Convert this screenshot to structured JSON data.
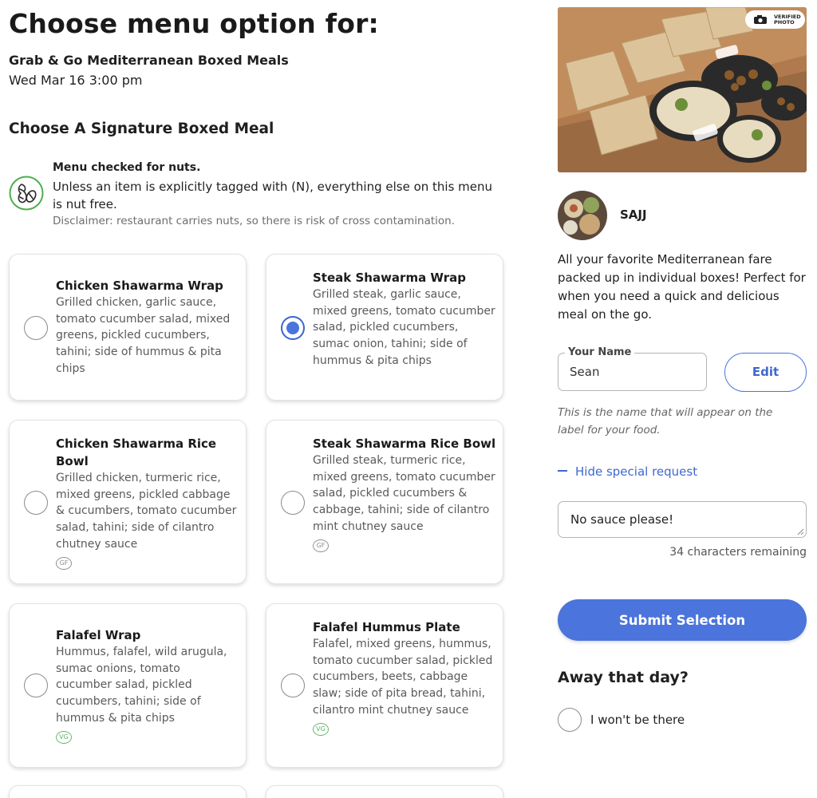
{
  "header": {
    "title": "Choose menu option for:",
    "event_name": "Grab & Go Mediterranean Boxed Meals",
    "event_date": "Wed Mar 16 3:00 pm",
    "section_title": "Choose A Signature Boxed Meal"
  },
  "nut_notice": {
    "icon": "nut-icon",
    "title": "Menu checked for nuts.",
    "text": "Unless an item is explicitly tagged with (N), everything else on this menu is nut free.",
    "disclaimer": "Disclaimer: restaurant carries nuts, so there is risk of cross contamination."
  },
  "menu_items": [
    {
      "name": "Chicken Shawarma Wrap",
      "description": "Grilled chicken, garlic sauce, tomato cucumber salad, mixed greens, pickled cucumbers, tahini; side of hummus & pita chips",
      "selected": false,
      "badge": ""
    },
    {
      "name": "Steak Shawarma Wrap",
      "description": "Grilled steak, garlic sauce, mixed greens, tomato cucumber salad, pickled cucumbers, sumac onion, tahini; side of hummus & pita chips",
      "selected": true,
      "badge": ""
    },
    {
      "name": "Chicken Shawarma Rice Bowl",
      "description": "Grilled chicken, turmeric rice, mixed greens, pickled cabbage & cucumbers, tomato cucumber salad, tahini; side of cilantro chutney sauce",
      "selected": false,
      "badge": "GF"
    },
    {
      "name": "Steak Shawarma Rice Bowl",
      "description": "Grilled steak, turmeric rice, mixed greens, tomato cucumber salad, pickled cucumbers & cabbage, tahini; side of cilantro mint chutney sauce",
      "selected": false,
      "badge": "GF"
    },
    {
      "name": "Falafel Wrap",
      "description": "Hummus, falafel, wild arugula, sumac onions, tomato cucumber salad, pickled cucumbers, tahini; side of hummus & pita chips",
      "selected": false,
      "badge": "VG"
    },
    {
      "name": "Falafel Hummus Plate",
      "description": "Falafel, mixed greens, hummus, tomato cucumber salad, pickled cucumbers, beets, cabbage slaw; side of pita bread, tahini, cilantro mint chutney sauce",
      "selected": false,
      "badge": "VG"
    }
  ],
  "restaurant": {
    "photo_badge_line1": "VERIFIED",
    "photo_badge_line2": "PHOTO",
    "name": "SAJJ",
    "description": "All your favorite Mediterranean fare packed up in individual boxes! Perfect for when you need a quick and delicious meal on the go."
  },
  "form": {
    "name_label": "Your Name",
    "name_value": "Sean",
    "edit_label": "Edit",
    "name_hint": "This is the name that will appear on the label for your food.",
    "toggle_request_label": "Hide special request",
    "special_request_value": "No sauce please!",
    "chars_remaining": "34 characters remaining",
    "submit_label": "Submit Selection",
    "away_heading": "Away that day?",
    "away_option_label": "I won't be there"
  },
  "colors": {
    "accent": "#4b74dc",
    "nut_icon_green": "#4caf50",
    "gf_badge": "#8f8f8f",
    "vg_badge": "#63b56c"
  }
}
